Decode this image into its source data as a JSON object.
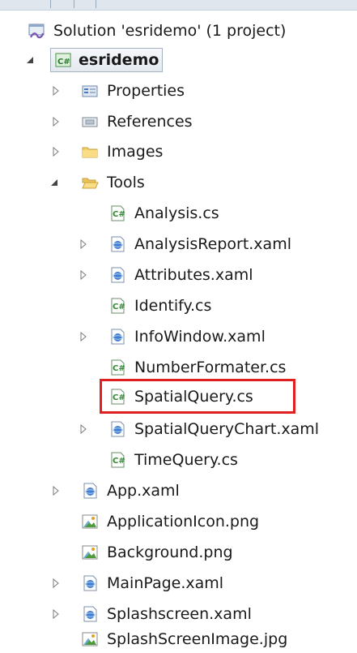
{
  "solution": {
    "label": "Solution 'esridemo' (1 project)",
    "icon": "solution-icon"
  },
  "project": {
    "label": "esridemo",
    "icon": "csharp-project-icon"
  },
  "folders": {
    "properties": {
      "label": "Properties",
      "icon": "properties-icon"
    },
    "references": {
      "label": "References",
      "icon": "references-icon"
    },
    "images": {
      "label": "Images",
      "icon": "folder-icon"
    },
    "tools": {
      "label": "Tools",
      "icon": "folder-open-icon"
    }
  },
  "tools_items": [
    {
      "label": "Analysis.cs",
      "icon": "csharp-file-icon",
      "expandable": false
    },
    {
      "label": "AnalysisReport.xaml",
      "icon": "xaml-file-icon",
      "expandable": true
    },
    {
      "label": "Attributes.xaml",
      "icon": "xaml-file-icon",
      "expandable": true
    },
    {
      "label": "Identify.cs",
      "icon": "csharp-file-icon",
      "expandable": false
    },
    {
      "label": "InfoWindow.xaml",
      "icon": "xaml-file-icon",
      "expandable": true
    },
    {
      "label": "NumberFormater.cs",
      "icon": "csharp-file-icon",
      "expandable": false
    },
    {
      "label": "SpatialQuery.cs",
      "icon": "csharp-file-icon",
      "expandable": false,
      "highlighted": true
    },
    {
      "label": "SpatialQueryChart.xaml",
      "icon": "xaml-file-icon",
      "expandable": true
    },
    {
      "label": "TimeQuery.cs",
      "icon": "csharp-file-icon",
      "expandable": false
    }
  ],
  "root_items": [
    {
      "label": "App.xaml",
      "icon": "xaml-file-icon",
      "expandable": true
    },
    {
      "label": "ApplicationIcon.png",
      "icon": "image-file-icon",
      "expandable": false
    },
    {
      "label": "Background.png",
      "icon": "image-file-icon",
      "expandable": false
    },
    {
      "label": "MainPage.xaml",
      "icon": "xaml-file-icon",
      "expandable": true
    },
    {
      "label": "Splashscreen.xaml",
      "icon": "xaml-file-icon",
      "expandable": true
    },
    {
      "label": "SplashScreenImage.jpg",
      "icon": "image-file-icon",
      "expandable": false
    }
  ],
  "colors": {
    "highlight_border": "#e02020",
    "expander": "#7a7a7a",
    "text": "#1a1a1a"
  }
}
